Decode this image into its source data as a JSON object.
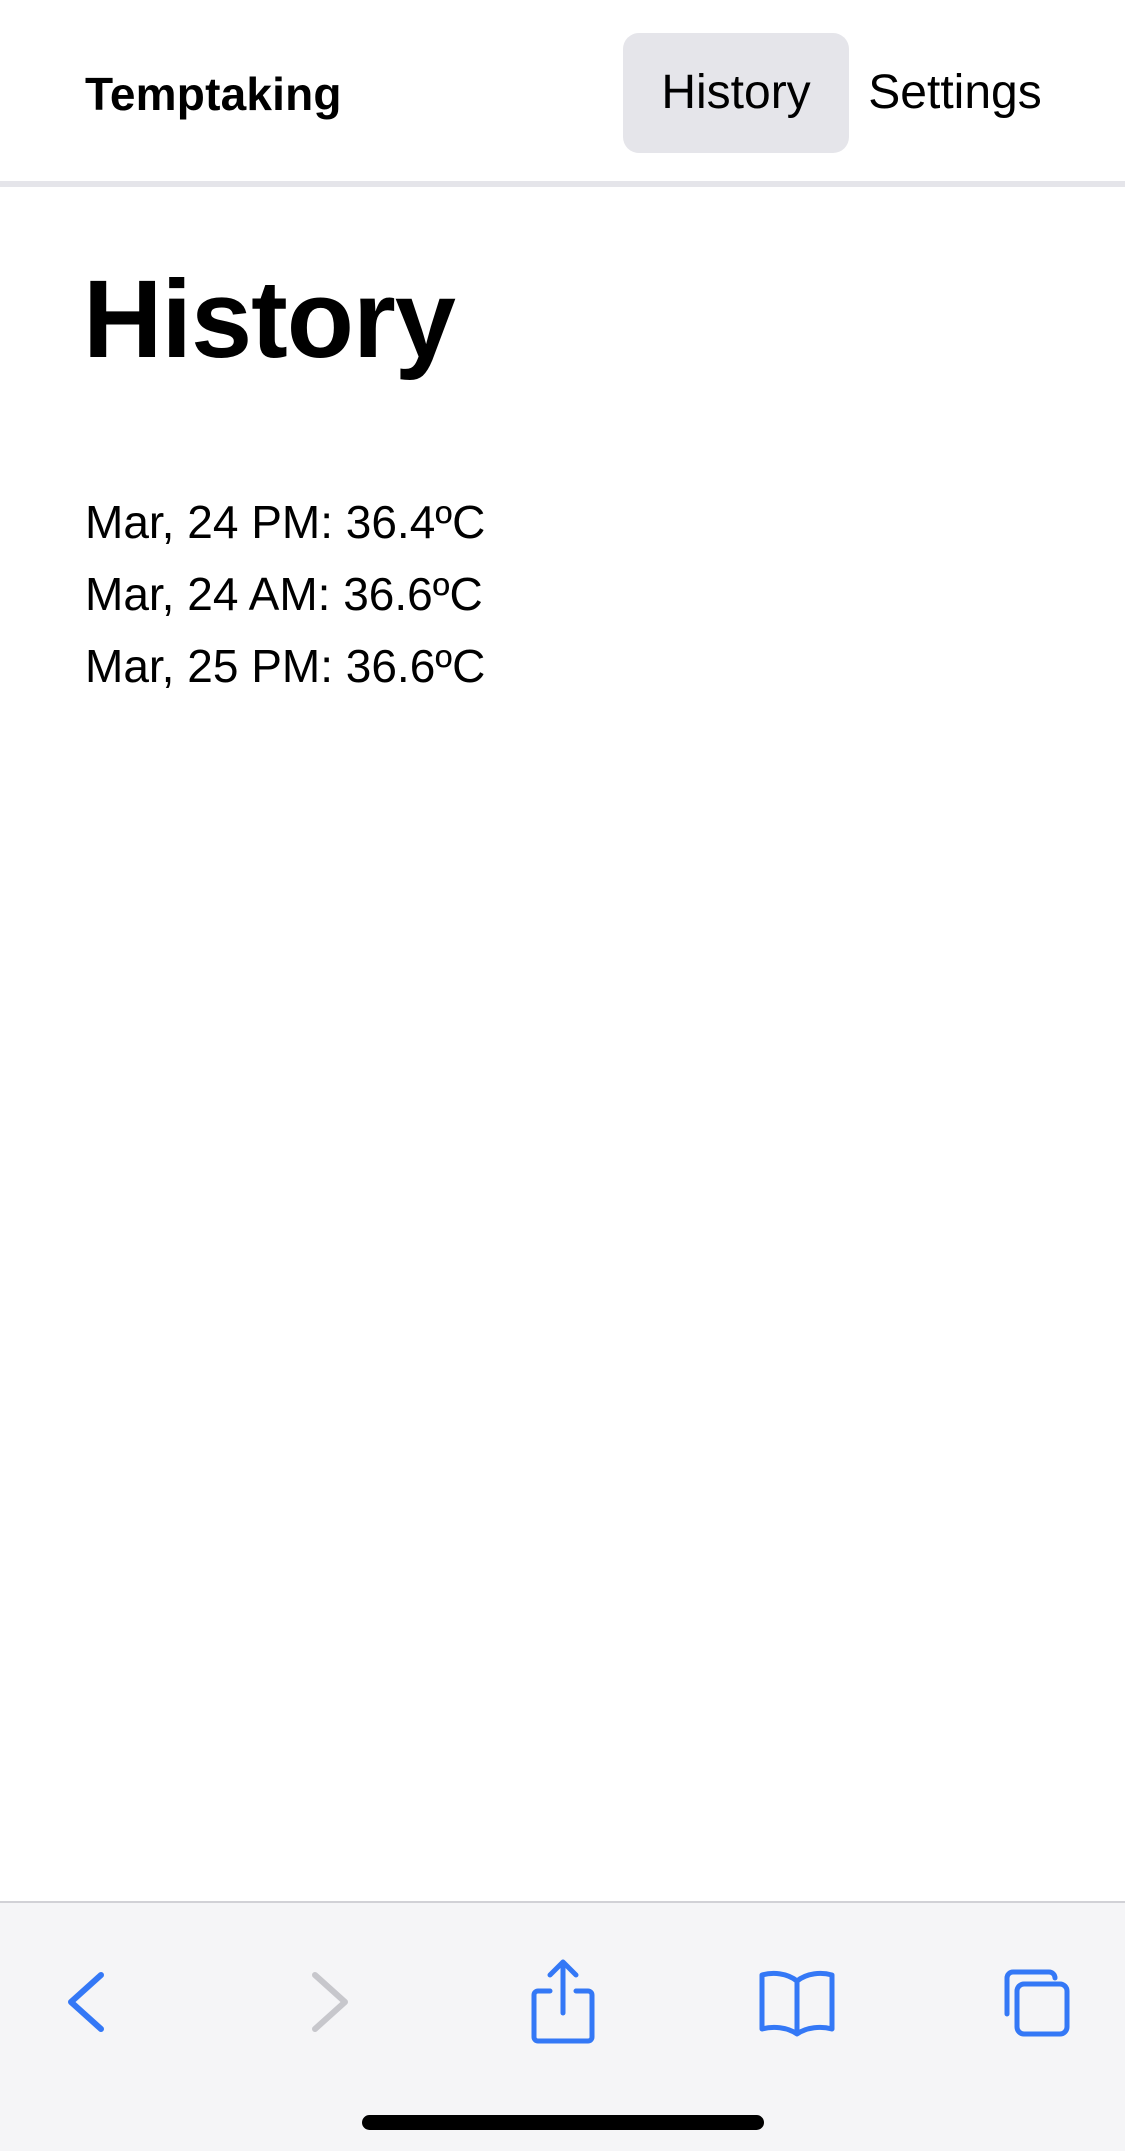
{
  "header": {
    "brand": "Temptaking",
    "tabs": [
      {
        "label": "History",
        "active": true
      },
      {
        "label": "Settings",
        "active": false
      }
    ]
  },
  "main": {
    "title": "History",
    "readings": [
      "Mar, 24 PM: 36.4ºC",
      "Mar, 24 AM: 36.6ºC",
      "Mar, 25 PM: 36.6ºC"
    ]
  },
  "toolbar": {
    "icons": [
      "back-icon",
      "forward-icon",
      "share-icon",
      "bookmarks-icon",
      "tabs-icon"
    ],
    "accent_color": "#3478f6",
    "disabled_color": "#c7c7cc"
  }
}
